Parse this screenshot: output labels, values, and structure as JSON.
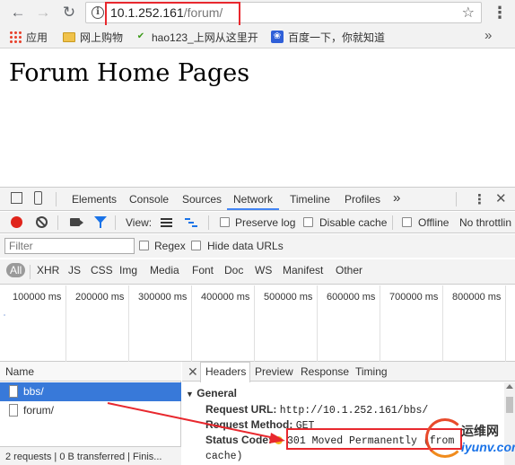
{
  "browser": {
    "url_host": "10.1.252.161",
    "url_path": "/forum/",
    "bookmarks": [
      {
        "label": "应用",
        "icon": "apps-grid-icon"
      },
      {
        "label": "网上购物",
        "icon": "folder-icon"
      },
      {
        "label": "hao123_上网从这里开",
        "icon": "hao123-icon"
      },
      {
        "label": "百度一下，你就知道",
        "icon": "baidu-paw-icon"
      }
    ],
    "more_bookmarks": "»"
  },
  "page": {
    "heading": "Forum Home Pages"
  },
  "devtools": {
    "tabs": [
      "Elements",
      "Console",
      "Sources",
      "Network",
      "Timeline",
      "Profiles"
    ],
    "active_tab": "Network",
    "more_tabs": "»",
    "toolbar": {
      "view_label": "View:",
      "preserve_log": "Preserve log",
      "disable_cache": "Disable cache",
      "offline": "Offline",
      "throttling": "No throttlin"
    },
    "filter": {
      "placeholder": "Filter",
      "regex": "Regex",
      "hide_data_urls": "Hide data URLs"
    },
    "types": [
      "All",
      "XHR",
      "JS",
      "CSS",
      "Img",
      "Media",
      "Font",
      "Doc",
      "WS",
      "Manifest",
      "Other"
    ],
    "timeline_labels": [
      "100000 ms",
      "200000 ms",
      "300000 ms",
      "400000 ms",
      "500000 ms",
      "600000 ms",
      "700000 ms",
      "800000 ms"
    ],
    "requests_header": "Name",
    "requests": [
      {
        "name": "bbs/",
        "selected": true
      },
      {
        "name": "forum/",
        "selected": false
      }
    ],
    "summary": "2 requests  |  0 B transferred  |  Finis...",
    "detail_tabs": [
      "Headers",
      "Preview",
      "Response",
      "Timing"
    ],
    "detail_active": "Headers",
    "general": {
      "title": "General",
      "request_url_label": "Request URL:",
      "request_url": "http://10.1.252.161/bbs/",
      "request_method_label": "Request Method:",
      "request_method": "GET",
      "status_code_label": "Status Code:",
      "status_code": "301 Moved Permanently  (from",
      "status_code_cont": "cache)",
      "status_color": "#f2b81c"
    }
  },
  "watermark": {
    "line1": "运维网",
    "line2": "iyunv.com"
  },
  "colors": {
    "annotation_red": "#e8282e",
    "selected_row": "#3879d9",
    "record_red": "#e0241b"
  }
}
